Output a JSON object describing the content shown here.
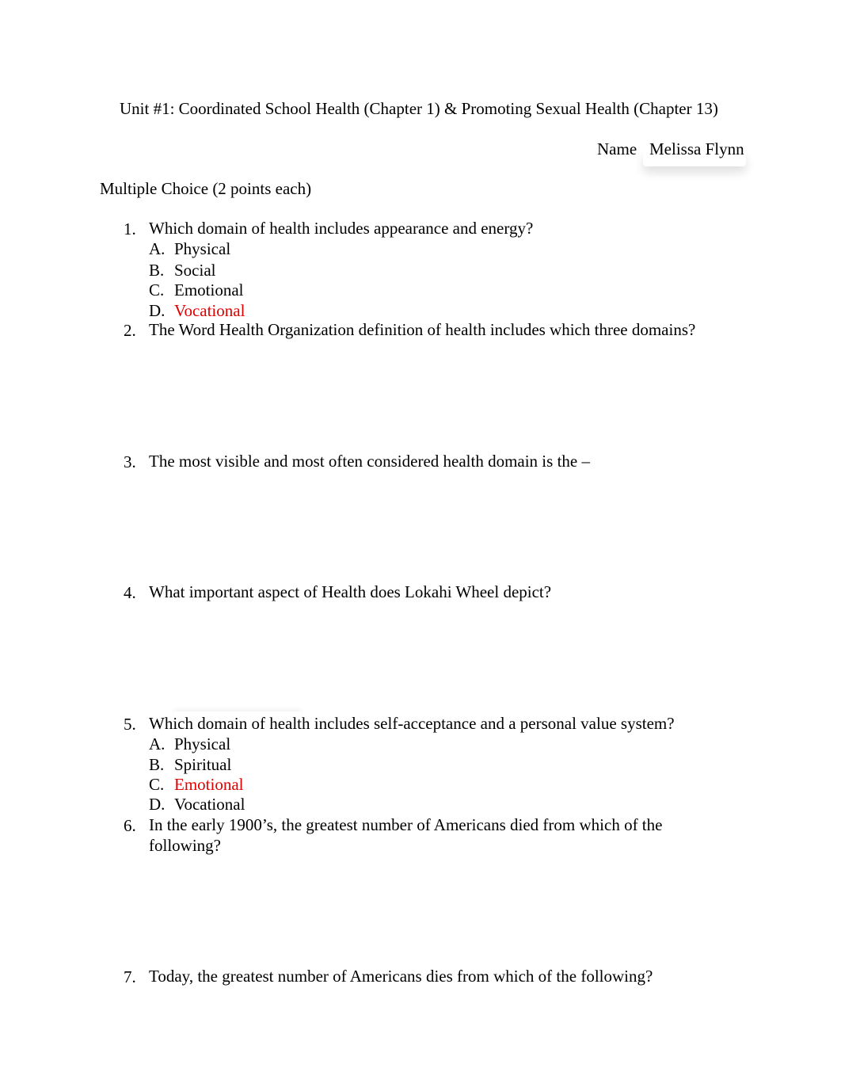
{
  "header": {
    "title": "Unit #1:  Coordinated School Health (Chapter 1) & Promoting Sexual Health (Chapter 13)",
    "name_label": "Name",
    "name_value": "Melissa Flynn"
  },
  "section": {
    "title": "Multiple Choice (2 points each)"
  },
  "accent_color": "#e00000",
  "questions": [
    {
      "number": "1.",
      "text": "Which domain of health includes appearance and energy?",
      "options": [
        {
          "letter": "A.",
          "text": "Physical",
          "selected": false
        },
        {
          "letter": "B.",
          "text": "Social",
          "selected": false
        },
        {
          "letter": "C.",
          "text": "Emotional",
          "selected": false
        },
        {
          "letter": "D.",
          "text": "Vocational",
          "selected": true
        }
      ]
    },
    {
      "number": "2.",
      "text": "The Word Health Organization definition of  health  includes which three domains?"
    },
    {
      "number": "3.",
      "text": "The most visible and most often considered health domain is the –"
    },
    {
      "number": "4.",
      "text": "What important aspect of Health does Lokahi Wheel depict?"
    },
    {
      "number": "5.",
      "text": "Which domain of health includes self-acceptance and a personal value system?",
      "options": [
        {
          "letter": "A.",
          "text": "Physical",
          "selected": false
        },
        {
          "letter": "B.",
          "text": "Spiritual",
          "selected": false
        },
        {
          "letter": "C.",
          "text": "Emotional",
          "selected": true
        },
        {
          "letter": "D.",
          "text": "Vocational",
          "selected": false
        }
      ]
    },
    {
      "number": "6.",
      "text": "In the early 1900’s, the greatest number of Americans died from which of the following?"
    },
    {
      "number": "7.",
      "text": "Today, the greatest number of Americans dies from which of the following?"
    }
  ]
}
